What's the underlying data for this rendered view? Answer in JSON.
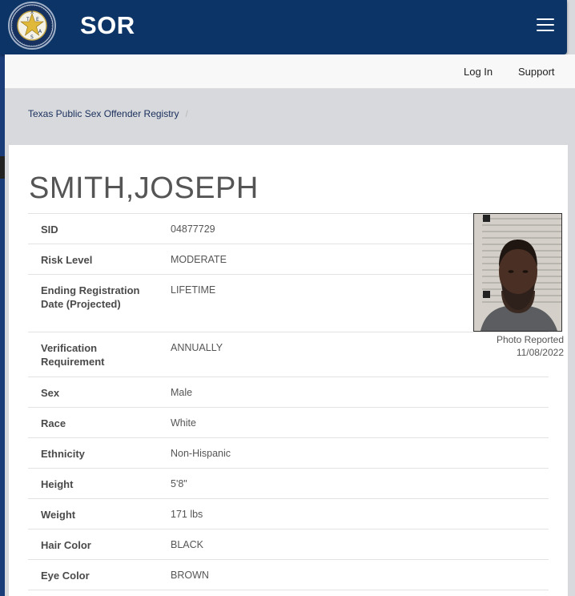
{
  "brand": {
    "title": "SOR",
    "seal_letters": [
      "T",
      "E",
      "X",
      "A",
      "S"
    ]
  },
  "nav": {
    "login_label": "Log In",
    "support_label": "Support"
  },
  "breadcrumb": {
    "item": "Texas Public Sex Offender Registry",
    "separator": "/"
  },
  "offender": {
    "name": "SMITH,JOSEPH",
    "photo_caption_line1": "Photo Reported",
    "photo_caption_line2": "11/08/2022",
    "rows": [
      {
        "label": "SID",
        "value": "04877729"
      },
      {
        "label": "Risk Level",
        "value": "MODERATE"
      },
      {
        "label": "Ending Registration Date (Projected)",
        "value": "LIFETIME"
      },
      {
        "label": "Verification Requirement",
        "value": "ANNUALLY"
      },
      {
        "label": "Sex",
        "value": "Male"
      },
      {
        "label": "Race",
        "value": "White"
      },
      {
        "label": "Ethnicity",
        "value": "Non-Hispanic"
      },
      {
        "label": "Height",
        "value": "5'8\""
      },
      {
        "label": "Weight",
        "value": "171 lbs"
      },
      {
        "label": "Hair Color",
        "value": "BLACK"
      },
      {
        "label": "Eye Color",
        "value": "BROWN"
      }
    ]
  },
  "colors": {
    "navbar": "#0d3466",
    "page_bg": "#d7d9dc",
    "card_bg": "#ffffff"
  },
  "icons": {
    "menu": "hamburger-icon",
    "logo": "dps-seal-logo"
  }
}
